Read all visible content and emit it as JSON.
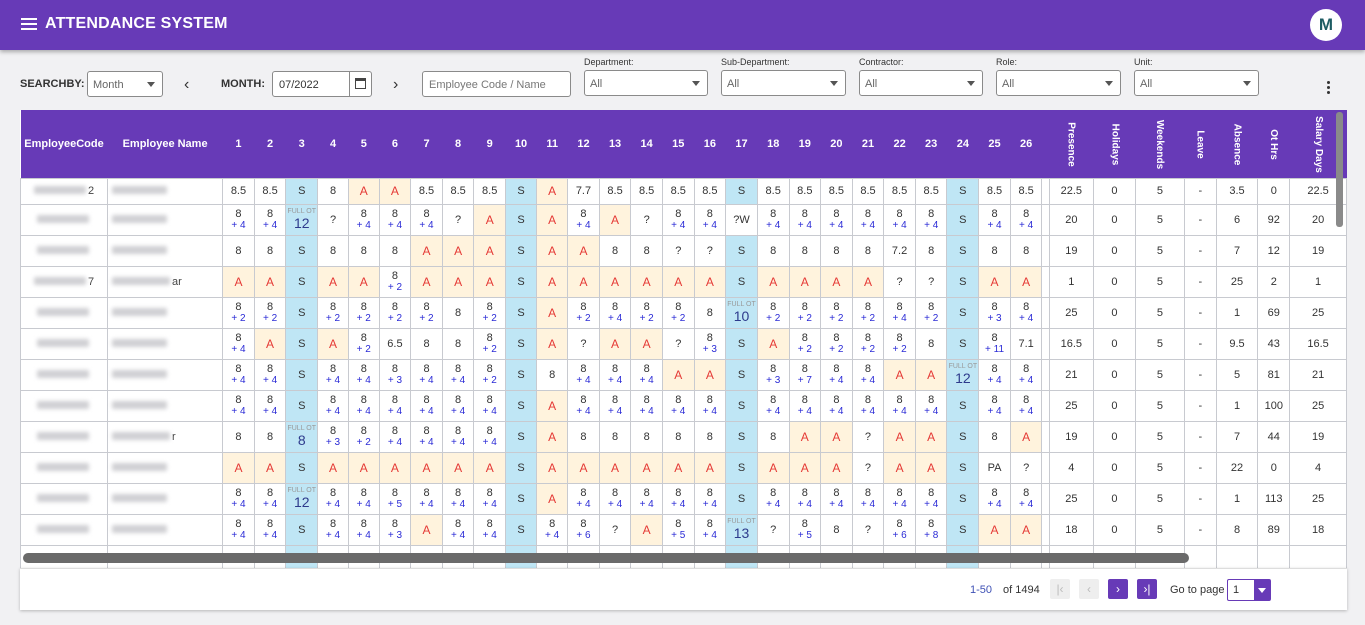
{
  "app": {
    "title": "ATTENDANCE SYSTEM",
    "avatar_letter": "M"
  },
  "filters": {
    "searchby_label": "SEARCHBY:",
    "searchby_value": "Month",
    "month_label": "MONTH:",
    "month_value": "07/2022",
    "employee_placeholder": "Employee Code / Name",
    "department": {
      "label": "Department:",
      "value": "All"
    },
    "sub_department": {
      "label": "Sub-Department:",
      "value": "All"
    },
    "contractor": {
      "label": "Contractor:",
      "value": "All"
    },
    "role": {
      "label": "Role:",
      "value": "All"
    },
    "unit": {
      "label": "Unit:",
      "value": "All"
    }
  },
  "table": {
    "headers": {
      "code": "EmployeeCode",
      "name": "Employee Name"
    },
    "days": [
      "1",
      "2",
      "3",
      "4",
      "5",
      "6",
      "7",
      "8",
      "9",
      "10",
      "11",
      "12",
      "13",
      "14",
      "15",
      "16",
      "17",
      "18",
      "19",
      "20",
      "21",
      "22",
      "23",
      "24",
      "25",
      "26"
    ],
    "summary_headers": [
      "Presence",
      "Holidays",
      "Weekends",
      "Leave",
      "Absence",
      "Ot Hrs",
      "Salary Days"
    ],
    "rows": [
      {
        "code": "2",
        "name": "",
        "cells": [
          "8.5",
          "8.5",
          "S",
          "8",
          "A",
          "A",
          "8.5",
          "8.5",
          "8.5",
          "S",
          "A",
          "7.7",
          "8.5",
          "8.5",
          "8.5",
          "8.5",
          "S",
          "8.5",
          "8.5",
          "8.5",
          "8.5",
          "8.5",
          "8.5",
          "S",
          "8.5",
          "8.5"
        ],
        "summary": [
          "22.5",
          "0",
          "5",
          "-",
          "3.5",
          "0",
          "22.5"
        ]
      },
      {
        "code": "",
        "name": "",
        "cells": [
          "8|+ 4",
          "8|+ 4",
          "FULL OT|12",
          "?",
          "8|+ 4",
          "8|+ 4",
          "8|+ 4",
          "?",
          "A",
          "S",
          "A",
          "8|+ 4",
          "A",
          "?",
          "8|+ 4",
          "8|+ 4",
          "?W",
          "8|+ 4",
          "8|+ 4",
          "8|+ 4",
          "8|+ 4",
          "8|+ 4",
          "8|+ 4",
          "S",
          "8|+ 4",
          "8|+ 4"
        ],
        "summary": [
          "20",
          "0",
          "5",
          "-",
          "6",
          "92",
          "20"
        ]
      },
      {
        "code": "",
        "name": "",
        "cells": [
          "8",
          "8",
          "S",
          "8",
          "8",
          "8",
          "A",
          "A",
          "A",
          "S",
          "A",
          "A",
          "8",
          "8",
          "?",
          "?",
          "S",
          "8",
          "8",
          "8",
          "8",
          "7.2",
          "8",
          "S",
          "8",
          "8"
        ],
        "summary": [
          "19",
          "0",
          "5",
          "-",
          "7",
          "12",
          "19"
        ]
      },
      {
        "code": "7",
        "name": "ar",
        "cells": [
          "A",
          "A",
          "S",
          "A",
          "A",
          "8|+ 2",
          "A",
          "A",
          "A",
          "S",
          "A",
          "A",
          "A",
          "A",
          "A",
          "A",
          "S",
          "A",
          "A",
          "A",
          "A",
          "?",
          "?",
          "S",
          "A",
          "A"
        ],
        "summary": [
          "1",
          "0",
          "5",
          "-",
          "25",
          "2",
          "1"
        ]
      },
      {
        "code": "",
        "name": "",
        "cells": [
          "8|+ 2",
          "8|+ 2",
          "S",
          "8|+ 2",
          "8|+ 2",
          "8|+ 2",
          "8|+ 2",
          "8",
          "8|+ 2",
          "S",
          "A",
          "8|+ 2",
          "8|+ 4",
          "8|+ 2",
          "8|+ 2",
          "8",
          "FULL OT|10",
          "8|+ 2",
          "8|+ 2",
          "8|+ 2",
          "8|+ 2",
          "8|+ 4",
          "8|+ 2",
          "S",
          "8|+ 3",
          "8|+ 4"
        ],
        "summary": [
          "25",
          "0",
          "5",
          "-",
          "1",
          "69",
          "25"
        ]
      },
      {
        "code": "",
        "name": "",
        "cells": [
          "8|+ 4",
          "A",
          "S",
          "A",
          "8|+ 2",
          "6.5",
          "8",
          "8",
          "8|+ 2",
          "S",
          "A",
          "?",
          "A",
          "A",
          "?",
          "8|+ 3",
          "S",
          "A",
          "8|+ 2",
          "8|+ 2",
          "8|+ 2",
          "8|+ 2",
          "8",
          "S",
          "8|+ 11",
          "7.1"
        ],
        "summary": [
          "16.5",
          "0",
          "5",
          "-",
          "9.5",
          "43",
          "16.5"
        ]
      },
      {
        "code": "",
        "name": "",
        "cells": [
          "8|+ 4",
          "8|+ 4",
          "S",
          "8|+ 4",
          "8|+ 4",
          "8|+ 3",
          "8|+ 4",
          "8|+ 4",
          "8|+ 2",
          "S",
          "8",
          "8|+ 4",
          "8|+ 4",
          "8|+ 4",
          "A",
          "A",
          "S",
          "8|+ 3",
          "8|+ 7",
          "8|+ 4",
          "8|+ 4",
          "A",
          "A",
          "FULL OT|12",
          "8|+ 4",
          "8|+ 4"
        ],
        "summary": [
          "21",
          "0",
          "5",
          "-",
          "5",
          "81",
          "21"
        ]
      },
      {
        "code": "",
        "name": "",
        "cells": [
          "8|+ 4",
          "8|+ 4",
          "S",
          "8|+ 4",
          "8|+ 4",
          "8|+ 4",
          "8|+ 4",
          "8|+ 4",
          "8|+ 4",
          "S",
          "A",
          "8|+ 4",
          "8|+ 4",
          "8|+ 4",
          "8|+ 4",
          "8|+ 4",
          "S",
          "8|+ 4",
          "8|+ 4",
          "8|+ 4",
          "8|+ 4",
          "8|+ 4",
          "8|+ 4",
          "S",
          "8|+ 4",
          "8|+ 4"
        ],
        "summary": [
          "25",
          "0",
          "5",
          "-",
          "1",
          "100",
          "25"
        ]
      },
      {
        "code": "",
        "name": "r",
        "cells": [
          "8",
          "8",
          "FULL OT|8",
          "8|+ 3",
          "8|+ 2",
          "8|+ 4",
          "8|+ 4",
          "8|+ 4",
          "8|+ 4",
          "S",
          "A",
          "8",
          "8",
          "8",
          "8",
          "8",
          "S",
          "8",
          "A",
          "A",
          "?",
          "A",
          "A",
          "S",
          "8",
          "A"
        ],
        "summary": [
          "19",
          "0",
          "5",
          "-",
          "7",
          "44",
          "19"
        ]
      },
      {
        "code": "",
        "name": "",
        "cells": [
          "A",
          "A",
          "S",
          "A",
          "A",
          "A",
          "A",
          "A",
          "A",
          "S",
          "A",
          "A",
          "A",
          "A",
          "A",
          "A",
          "S",
          "A",
          "A",
          "A",
          "?",
          "A",
          "A",
          "S",
          "PA",
          "?"
        ],
        "summary": [
          "4",
          "0",
          "5",
          "-",
          "22",
          "0",
          "4"
        ]
      },
      {
        "code": "",
        "name": "",
        "cells": [
          "8|+ 4",
          "8|+ 4",
          "FULL OT|12",
          "8|+ 4",
          "8|+ 4",
          "8|+ 5",
          "8|+ 4",
          "8|+ 4",
          "8|+ 4",
          "S",
          "A",
          "8|+ 4",
          "8|+ 4",
          "8|+ 4",
          "8|+ 4",
          "8|+ 4",
          "S",
          "8|+ 4",
          "8|+ 4",
          "8|+ 4",
          "8|+ 4",
          "8|+ 4",
          "8|+ 4",
          "S",
          "8|+ 4",
          "8|+ 4"
        ],
        "summary": [
          "25",
          "0",
          "5",
          "-",
          "1",
          "113",
          "25"
        ]
      },
      {
        "code": "",
        "name": "",
        "cells": [
          "8|+ 4",
          "8|+ 4",
          "S",
          "8|+ 4",
          "8|+ 4",
          "8|+ 3",
          "A",
          "8|+ 4",
          "8|+ 4",
          "S",
          "8|+ 4",
          "8|+ 6",
          "?",
          "A",
          "8|+ 5",
          "8|+ 4",
          "FULL OT|13",
          "?",
          "8|+ 5",
          "8",
          "?",
          "8|+ 6",
          "8|+ 8",
          "S",
          "A",
          "A"
        ],
        "summary": [
          "18",
          "0",
          "5",
          "-",
          "8",
          "89",
          "18"
        ]
      }
    ]
  },
  "pagination": {
    "range": "1-50",
    "of_text": "of 1494",
    "goto_label": "Go to page",
    "goto_value": "1"
  },
  "colors": {
    "primary": "#673ab7",
    "weekend": "#bfe6f5",
    "absent_bg": "#fff3dd",
    "absent_text": "#e53935",
    "ot_text": "#2b2bd6"
  }
}
